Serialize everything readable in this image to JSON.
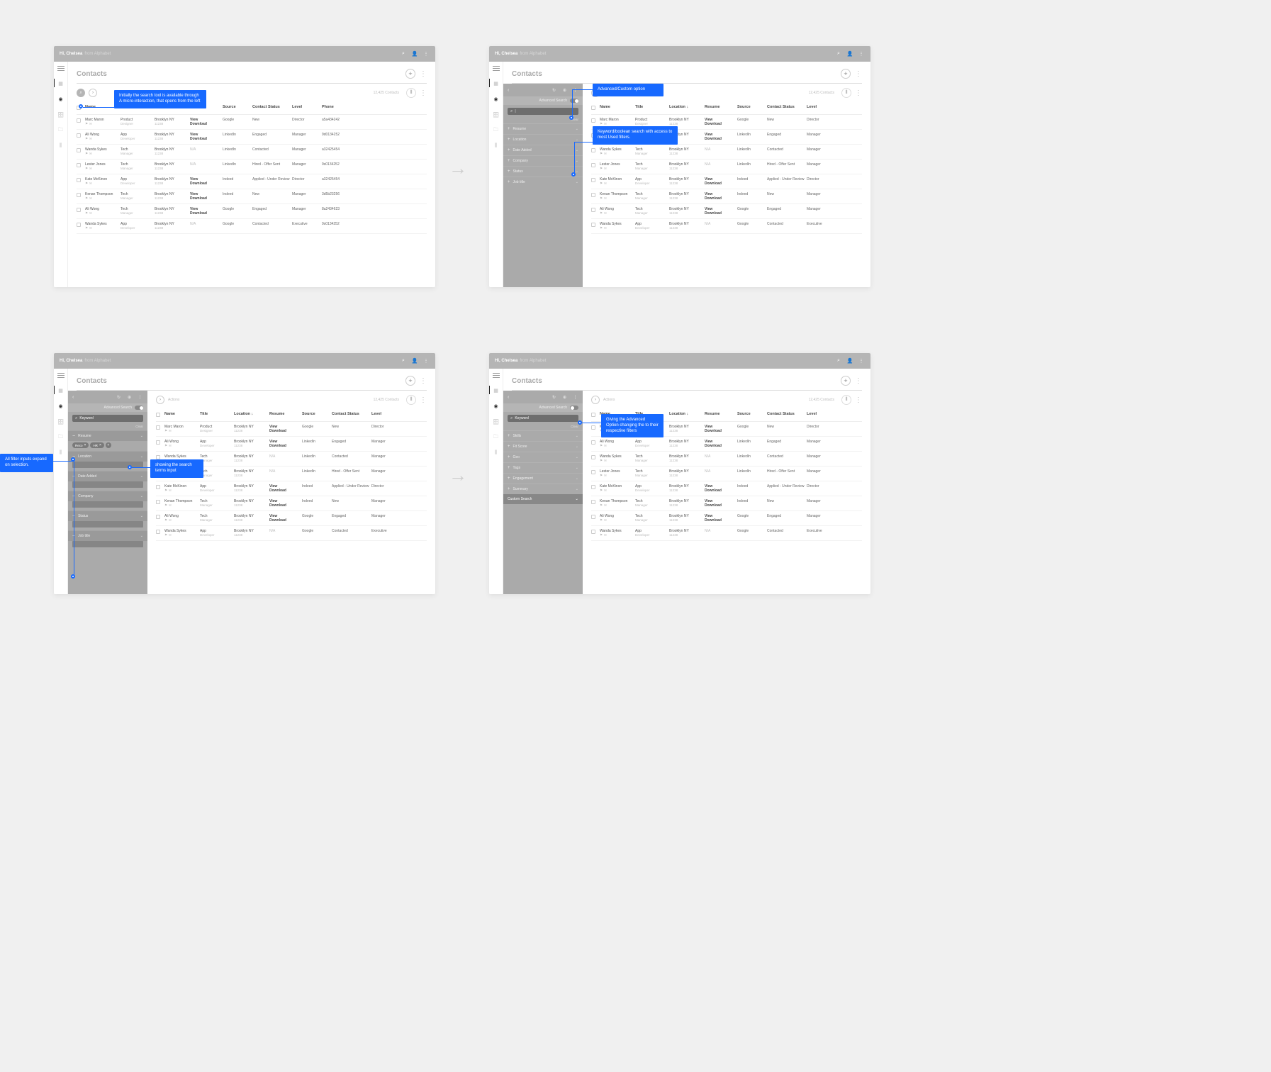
{
  "topbar": {
    "hi": "Hi, Chelsea",
    "from": "from Alphabet"
  },
  "page": {
    "title": "Contacts",
    "count": "12,425 Contacts",
    "actions": "Actions"
  },
  "cols": {
    "name": "Name",
    "title": "Title",
    "loc": "Location",
    "loc_s": "Location ↓",
    "res": "Resume",
    "src": "Source",
    "stat": "Contact Status",
    "lvl": "Level",
    "ph": "Phone"
  },
  "res": {
    "vd1": "View",
    "vd2": "Download",
    "na": "N/A"
  },
  "rows": [
    {
      "name": "Marc Maron",
      "title1": "Product",
      "title2": "Designer",
      "loc1": "Brooklyn NY",
      "loc2": "11238",
      "res": "vd",
      "src": "Google",
      "stat": "New",
      "lvl": "Director",
      "ph": "a5a434242"
    },
    {
      "name": "Ali Wong",
      "title1": "App",
      "title2": "Developer",
      "loc1": "Brooklyn NY",
      "loc2": "11238",
      "res": "vd",
      "src": "LinkedIn",
      "stat": "Engaged",
      "lvl": "Manager",
      "ph": "9d0134252"
    },
    {
      "name": "Wanda Sykes",
      "title1": "Tech",
      "title2": "Manager",
      "loc1": "Brooklyn NY",
      "loc2": "11238",
      "res": "na",
      "src": "LinkedIn",
      "stat": "Contacted",
      "lvl": "Manager",
      "ph": "a32425454"
    },
    {
      "name": "Lester Jones",
      "title1": "Tech",
      "title2": "Manager",
      "loc1": "Brooklyn NY",
      "loc2": "11238",
      "res": "na",
      "src": "LinkedIn",
      "stat": "Hired - Offer Sent",
      "lvl": "Manager",
      "ph": "9s0134252"
    },
    {
      "name": "Kate McKinon",
      "title1": "App",
      "title2": "Developer",
      "loc1": "Brooklyn NY",
      "loc2": "11238",
      "res": "vd",
      "src": "Indeed",
      "stat": "Applied - Under Review",
      "lvl": "Director",
      "ph": "a32425454"
    },
    {
      "name": "Kenan Thompson",
      "title1": "Tech",
      "title2": "Manager",
      "loc1": "Brooklyn NY",
      "loc2": "11238",
      "res": "vd",
      "src": "Indeed",
      "stat": "New",
      "lvl": "Manager",
      "ph": "3d5b23256"
    },
    {
      "name": "Ali Wong",
      "title1": "Tech",
      "title2": "Manager",
      "loc1": "Brooklyn NY",
      "loc2": "11238",
      "res": "vd",
      "src": "Google",
      "stat": "Engaged",
      "lvl": "Manager",
      "ph": "8a2434623"
    },
    {
      "name": "Wanda Sykes",
      "title1": "App",
      "title2": "Developer",
      "loc1": "Brooklyn NY",
      "loc2": "11238",
      "res": "na",
      "src": "Google",
      "stat": "Contacted",
      "lvl": "Executive",
      "ph": "9s0134252"
    }
  ],
  "panel": {
    "adv": "Advanced Search",
    "clear": "Clear",
    "kw": "Keyword",
    "basic": [
      "Resume",
      "Location",
      "Date Added",
      "Company",
      "Status",
      "Job title"
    ],
    "adv_filters": [
      "Skills",
      "Fit Score",
      "Geo",
      "Tags",
      "Engagement",
      "Summary"
    ],
    "custom": "Custom Search",
    "chip1": "Reco",
    "chip2": "HR"
  },
  "anno": {
    "a1": "Initially the search tool is available through A micro-interaction, that opens from the left",
    "a2": "Advanced/Custom option",
    "a3": "Keyword/boolean search with access to most Used filters.",
    "a4": "All filter inputs expand on selection.",
    "a5": "showing the search terms input",
    "a6": "Giving the Advanced Option changing the to their respective filters"
  }
}
